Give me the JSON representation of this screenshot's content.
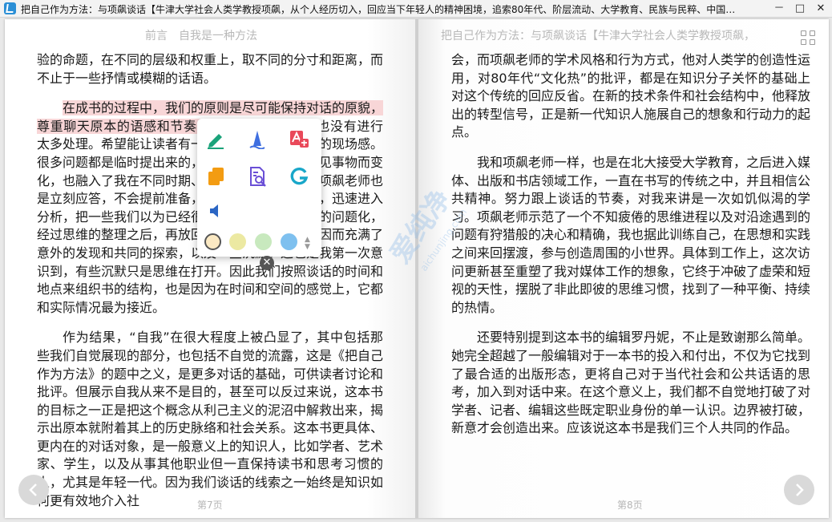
{
  "window": {
    "title": "把自己作为方法：与项飙谈话【牛津大学社会人类学教授项飙，从个人经历切入，回应当下年轻人的精神困境，追索80年代、阶层流动、大学教育、民族与民粹、中国…",
    "min_label": "－",
    "max_label": "□",
    "close_label": "✕"
  },
  "left_page": {
    "header": "前言　自我是一种方法",
    "paragraphs": [
      {
        "text": "验的命题，在不同的层级和权重上，取不同的分寸和距离，而不止于一些抒情或模糊的话语。"
      },
      {
        "highlight": "在成书的过程中，我们的原则是尽可能保持对话的原貌，尊重聊天原本的语感和节奏，",
        "text": "保留对话的特点，也没有进行太多处理。希望能让读者有一种在场感，保持一定的现场感。很多问题都是临时提出来的，随着谈话的展开和所见事物而变化，也融入了我在不同时期、不同情境中的疑惑，项飙老师也是立刻应答，不会提前准备，随机应变，当场回答，迅速进入分析，把一些我们以为已经很熟悉的事情，变成新的问题化，经过思维的整理之后，再放回原处。整个谈话过程因而充满了意外的发现和共同的探索，以及一些沉默。这也是我第一次意识到，有些沉默只是思维在打开。因此我们按照谈话的时间和地点来组织书的结构，也是因为在时间和空间的感觉上，它都和实际情况最为接近。"
      },
      {
        "text": "作为结果，“自我”在很大程度上被凸显了，其中包括那些我们自觉展现的部分，也包括不自觉的流露，这是《把自己作为方法》的题中之义，是更多对话的基础，可供读者讨论和批评。但展示自我从来不是目的，甚至可以反过来说，这本书的目标之一正是把这个概念从利己主义的泥沼中解救出来，揭示出原本就附着其上的历史脉络和社会关系。这本书更具体、更内在的对话对象，是一般意义上的知识人，比如学者、艺术家、学生，以及从事其他职业但一直保持读书和思考习惯的人，尤其是年轻一代。因为我们谈话的线索之一始终是知识如何更有效地介入社"
      }
    ],
    "page_number": "第7页"
  },
  "right_page": {
    "header": "把自己作为方法：与项飙谈话【牛津大学社会人类学教授项飙，",
    "paragraphs": [
      {
        "text": "会，而项飙老师的学术风格和行为方式，他对人类学的创造性运用，对80年代“文化热”的批评，都是在知识分子关怀的基础上对这个传统的回应反省。在新的技术条件和社会结构中，他释放出的转型信号，正是新一代知识人施展自己的想象和行动力的起点。"
      },
      {
        "text": "我和项飙老师一样，也是在北大接受大学教育，之后进入媒体、出版和书店领域工作，一直在书写的传统之中，并且相信公共精神。努力跟上谈话的节奏，对我来讲是一次如饥似渴的学习。项飙老师示范了一个不知疲倦的思维进程以及对沿途遇到的问题有狩猎般的决心和精确，我也据此训练自己，在思想和实践之间来回摆渡，参与创造周围的小世界。具体到工作上，这次访问更新甚至重塑了我对媒体工作的想象，它终于冲破了虚荣和短视的天性，摆脱了非此即彼的思维习惯，找到了一种平衡、持续的热情。"
      },
      {
        "text": "还要特别提到这本书的编辑罗丹妮，不止是致谢那么简单。她完全超越了一般编辑对于一本书的投入和付出，不仅为它找到了最合适的出版形态，更将自己对于当代社会和公共话语的思考，加入到对话中来。在这个意义上，我们都不自觉地打破了对学者、记者、编辑这些既定职业身份的单一认识。边界被打破，新意才会创造出来。应该说这本书是我们三个人共同的作品。"
      }
    ],
    "page_number": "第8页"
  },
  "toolbar": {
    "tools": [
      {
        "name": "highlighter-pen-icon",
        "color": "#1aa37a"
      },
      {
        "name": "underline-wave-icon",
        "color": "#3f6fe0"
      },
      {
        "name": "translate-icon",
        "color": "#e9495a"
      },
      {
        "name": "copy-icon",
        "color": "#f39c12"
      },
      {
        "name": "search-document-icon",
        "color": "#6a4fd6"
      },
      {
        "name": "google-search-icon",
        "color": "#19a7c9"
      },
      {
        "name": "speaker-icon",
        "color": "#2b66c4"
      }
    ],
    "swatches": [
      "#fbe9c3",
      "#ece9a2",
      "#c8e9be",
      "#7ec0ef"
    ]
  },
  "watermark": {
    "text": "爱纯净",
    "sub": "aichunjing.com"
  }
}
